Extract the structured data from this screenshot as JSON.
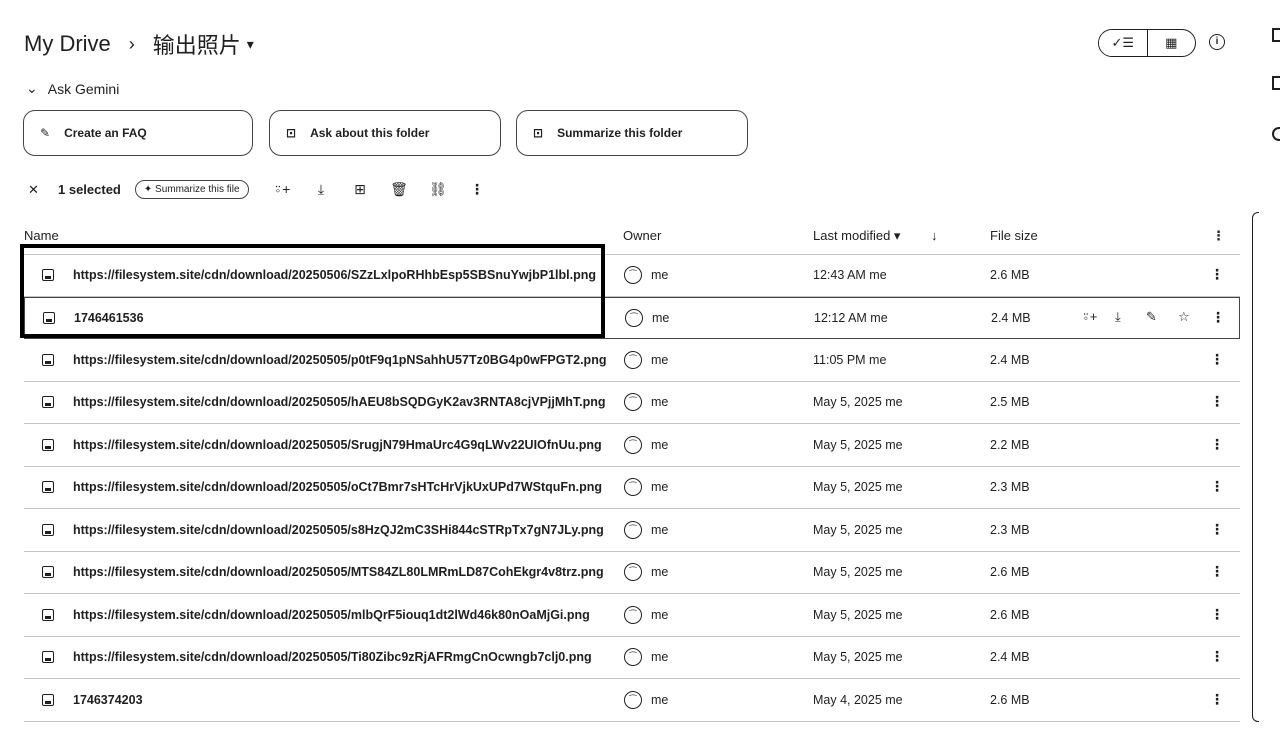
{
  "breadcrumb": {
    "root": "My Drive",
    "separator": "›",
    "folder": "输出照片",
    "caret": "▾"
  },
  "view": {
    "list_icon": "✓☰",
    "grid_icon": "▦",
    "info_icon": "i"
  },
  "ask_gemini": {
    "toggle_icon": "⌄",
    "label": "Ask Gemini"
  },
  "chips": [
    {
      "icon": "✎",
      "label": "Create an FAQ"
    },
    {
      "icon": "⊡",
      "label": "Ask about this folder"
    },
    {
      "icon": "⊡",
      "label": "Summarize this folder"
    }
  ],
  "selection": {
    "close_icon": "✕",
    "count_label": "1 selected",
    "summarize_label": "✦ Summarize this file",
    "actions": [
      {
        "name": "share-icon",
        "glyph": "⍤+"
      },
      {
        "name": "download-icon",
        "glyph": "⤓"
      },
      {
        "name": "move-icon",
        "glyph": "⊞"
      },
      {
        "name": "trash-icon",
        "glyph": "🗑"
      },
      {
        "name": "link-icon",
        "glyph": "⛓"
      },
      {
        "name": "more-vert-icon",
        "glyph": "⋮"
      }
    ]
  },
  "columns": {
    "name": "Name",
    "owner": "Owner",
    "modified": "Last modified ▾",
    "sort_icon": "↓",
    "size": "File size",
    "more": "⋮"
  },
  "rows": [
    {
      "name": "https://filesystem.site/cdn/download/20250506/SZzLxlpoRHhbEsp5SBSnuYwjbP1lbl.png",
      "owner": "me",
      "modified": "12:43 AM me",
      "size": "2.6 MB"
    },
    {
      "name": "1746461536",
      "owner": "me",
      "modified": "12:12 AM me",
      "size": "2.4 MB"
    },
    {
      "name": "https://filesystem.site/cdn/download/20250505/p0tF9q1pNSahhU57Tz0BG4p0wFPGT2.png",
      "owner": "me",
      "modified": "11:05 PM me",
      "size": "2.4 MB"
    },
    {
      "name": "https://filesystem.site/cdn/download/20250505/hAEU8bSQDGyK2av3RNTA8cjVPjjMhT.png",
      "owner": "me",
      "modified": "May 5, 2025 me",
      "size": "2.5 MB"
    },
    {
      "name": "https://filesystem.site/cdn/download/20250505/SrugjN79HmaUrc4G9qLWv22UIOfnUu.png",
      "owner": "me",
      "modified": "May 5, 2025 me",
      "size": "2.2 MB"
    },
    {
      "name": "https://filesystem.site/cdn/download/20250505/oCt7Bmr7sHTcHrVjkUxUPd7WStquFn.png",
      "owner": "me",
      "modified": "May 5, 2025 me",
      "size": "2.3 MB"
    },
    {
      "name": "https://filesystem.site/cdn/download/20250505/s8HzQJ2mC3SHi844cSTRpTx7gN7JLy.png",
      "owner": "me",
      "modified": "May 5, 2025 me",
      "size": "2.3 MB"
    },
    {
      "name": "https://filesystem.site/cdn/download/20250505/MTS84ZL80LMRmLD87CohEkgr4v8trz.png",
      "owner": "me",
      "modified": "May 5, 2025 me",
      "size": "2.6 MB"
    },
    {
      "name": "https://filesystem.site/cdn/download/20250505/mlbQrF5iouq1dt2lWd46k80nOaMjGi.png",
      "owner": "me",
      "modified": "May 5, 2025 me",
      "size": "2.6 MB"
    },
    {
      "name": "https://filesystem.site/cdn/download/20250505/Ti80Zibc9zRjAFRmgCnOcwngb7clj0.png",
      "owner": "me",
      "modified": "May 5, 2025 me",
      "size": "2.4 MB"
    },
    {
      "name": "1746374203",
      "owner": "me",
      "modified": "May 4, 2025 me",
      "size": "2.6 MB"
    }
  ],
  "hover_actions": [
    {
      "name": "share-icon",
      "glyph": "⍤+"
    },
    {
      "name": "download-icon",
      "glyph": "⤓"
    },
    {
      "name": "rename-icon",
      "glyph": "✎"
    },
    {
      "name": "star-icon",
      "glyph": "☆"
    }
  ]
}
